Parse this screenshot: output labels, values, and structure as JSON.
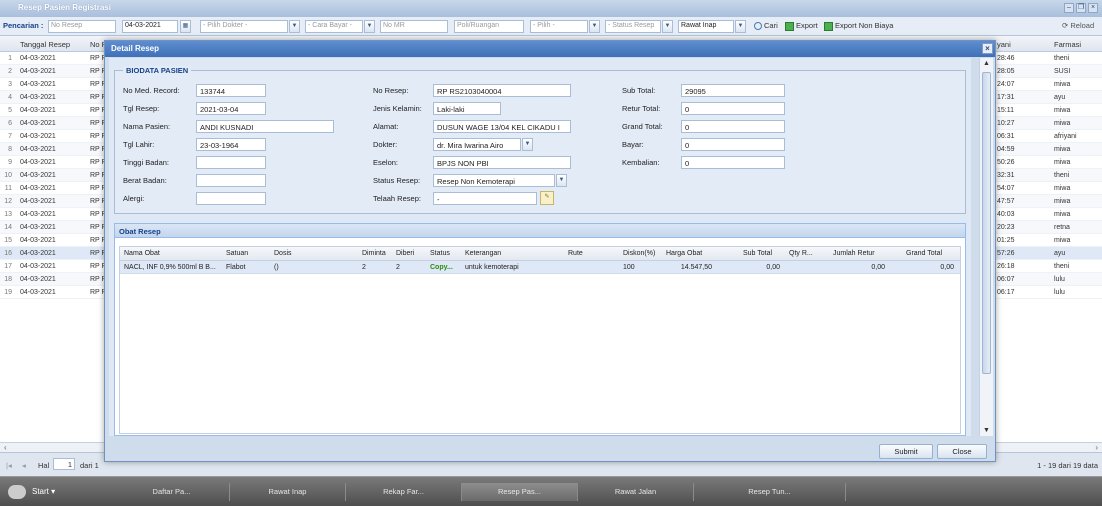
{
  "window": {
    "title": "Resep Pasien Registrasi",
    "reload": "Reload"
  },
  "toolbar": {
    "search_label": "Pencarian :",
    "no_resep_ph": "No Resep",
    "date": "04-03-2021",
    "dokter_ph": "- Pilih Dokter -",
    "cara_bayar_ph": "- Cara Bayar -",
    "no_mr_ph": "No MR",
    "poli_ph": "Poli/Ruangan",
    "pilih_ph": "- Pilih -",
    "status_resep_ph": "- Status Resep",
    "rawat": "Rawat Inap",
    "cari": "Cari",
    "export": "Export",
    "export_non_biaya": "Export Non Biaya"
  },
  "grid": {
    "headers": {
      "tanggal": "Tanggal Resep",
      "no": "No R",
      "petugas": "yani",
      "farmasi": "Farmasi"
    },
    "rows": [
      {
        "n": "1",
        "date": "04-03-2021",
        "no": "RP R",
        "time": "28:46",
        "farmasi": "theni"
      },
      {
        "n": "2",
        "date": "04-03-2021",
        "no": "RP R",
        "time": "28:05",
        "farmasi": "SUSI"
      },
      {
        "n": "3",
        "date": "04-03-2021",
        "no": "RP R",
        "time": "24:07",
        "farmasi": "miwa"
      },
      {
        "n": "4",
        "date": "04-03-2021",
        "no": "RP R",
        "time": "17:31",
        "farmasi": "ayu"
      },
      {
        "n": "5",
        "date": "04-03-2021",
        "no": "RP R",
        "time": "15:11",
        "farmasi": "miwa"
      },
      {
        "n": "6",
        "date": "04-03-2021",
        "no": "RP R",
        "time": "10:27",
        "farmasi": "miwa"
      },
      {
        "n": "7",
        "date": "04-03-2021",
        "no": "RP R",
        "time": "06:31",
        "farmasi": "afriyani"
      },
      {
        "n": "8",
        "date": "04-03-2021",
        "no": "RP R",
        "time": "04:59",
        "farmasi": "miwa"
      },
      {
        "n": "9",
        "date": "04-03-2021",
        "no": "RP R",
        "time": "50:26",
        "farmasi": "miwa"
      },
      {
        "n": "10",
        "date": "04-03-2021",
        "no": "RP R",
        "time": "32:31",
        "farmasi": "theni"
      },
      {
        "n": "11",
        "date": "04-03-2021",
        "no": "RP R",
        "time": "54:07",
        "farmasi": "miwa"
      },
      {
        "n": "12",
        "date": "04-03-2021",
        "no": "RP R",
        "time": "47:57",
        "farmasi": "miwa"
      },
      {
        "n": "13",
        "date": "04-03-2021",
        "no": "RP R",
        "time": "40:03",
        "farmasi": "miwa"
      },
      {
        "n": "14",
        "date": "04-03-2021",
        "no": "RP R",
        "time": "20:23",
        "farmasi": "retna"
      },
      {
        "n": "15",
        "date": "04-03-2021",
        "no": "RP R",
        "time": "01:25",
        "farmasi": "miwa"
      },
      {
        "n": "16",
        "date": "04-03-2021",
        "no": "RP R",
        "time": "57:26",
        "farmasi": "ayu"
      },
      {
        "n": "17",
        "date": "04-03-2021",
        "no": "RP R",
        "time": "26:18",
        "farmasi": "theni"
      },
      {
        "n": "18",
        "date": "04-03-2021",
        "no": "RP R",
        "time": "06:07",
        "farmasi": "lulu"
      },
      {
        "n": "19",
        "date": "04-03-2021",
        "no": "RP R",
        "time": "06:17",
        "farmasi": "lulu"
      }
    ]
  },
  "pager": {
    "hal": "Hal",
    "page": "1",
    "dari": "dari 1",
    "summary": "1 - 19 dari 19 data"
  },
  "dialog": {
    "title": "Detail Resep",
    "biodata_legend": "BIODATA PASIEN",
    "labels": {
      "no_mr": "No Med. Record:",
      "tgl_resep": "Tgl Resep:",
      "nama": "Nama Pasien:",
      "tgl_lahir": "Tgl Lahir:",
      "tinggi": "Tinggi Badan:",
      "berat": "Berat Badan:",
      "alergi": "Alergi:",
      "no_resep": "No Resep:",
      "jk": "Jenis Kelamin:",
      "alamat": "Alamat:",
      "dokter": "Dokter:",
      "eselon": "Eselon:",
      "status_resep": "Status Resep:",
      "telaah": "Telaah Resep:",
      "sub_total": "Sub Total:",
      "retur_total": "Retur Total:",
      "grand_total": "Grand Total:",
      "bayar": "Bayar:",
      "kembalian": "Kembalian:"
    },
    "values": {
      "no_mr": "133744",
      "tgl_resep": "2021-03-04",
      "nama": "ANDI KUSNADI",
      "tgl_lahir": "23-03-1964",
      "tinggi": "",
      "berat": "",
      "alergi": "",
      "no_resep": "RP RS2103040004",
      "jk": "Laki-laki",
      "alamat": "DUSUN WAGE 13/04 KEL CIKADU I",
      "dokter": "dr. Mira Iwarina Airo",
      "eselon": "BPJS NON PBI",
      "status_resep": "Resep Non Kemoterapi",
      "telaah": "-",
      "sub_total": "29095",
      "retur_total": "0",
      "grand_total": "0",
      "bayar": "0",
      "kembalian": "0"
    },
    "obat_title": "Obat Resep",
    "obat_headers": {
      "nama": "Nama Obat",
      "satuan": "Satuan",
      "dosis": "Dosis",
      "diminta": "Diminta",
      "diberi": "Diberi",
      "status": "Status",
      "keterangan": "Keterangan",
      "rute": "Rute",
      "diskon": "Diskon(%)",
      "harga": "Harga Obat",
      "subtotal": "Sub Total",
      "qty_r": "Qty R...",
      "jumlah_retur": "Jumlah Retur",
      "grand_total": "Grand Total"
    },
    "obat_row": {
      "nama": "NACL, INF 0,9% 500ml B B...",
      "satuan": "Flabot",
      "dosis": "()",
      "diminta": "2",
      "diberi": "2",
      "status": "Copy...",
      "keterangan": "untuk kemoterapi",
      "rute": "",
      "diskon": "100",
      "harga": "14.547,50",
      "subtotal": "0,00",
      "qty_r": "",
      "jumlah_retur": "0,00",
      "grand_total": "0,00"
    },
    "submit": "Submit",
    "close": "Close"
  },
  "taskbar": {
    "start": "Start",
    "items": [
      "Daftar Pa...",
      "Rawat Inap",
      "Rekap Far...",
      "Resep Pas...",
      "Rawat Jalan",
      "Resep Tun..."
    ]
  },
  "colors": {
    "accent": "#15428b",
    "dialog_title": "#3f6fb6",
    "status_copy": "#2e8b12"
  }
}
